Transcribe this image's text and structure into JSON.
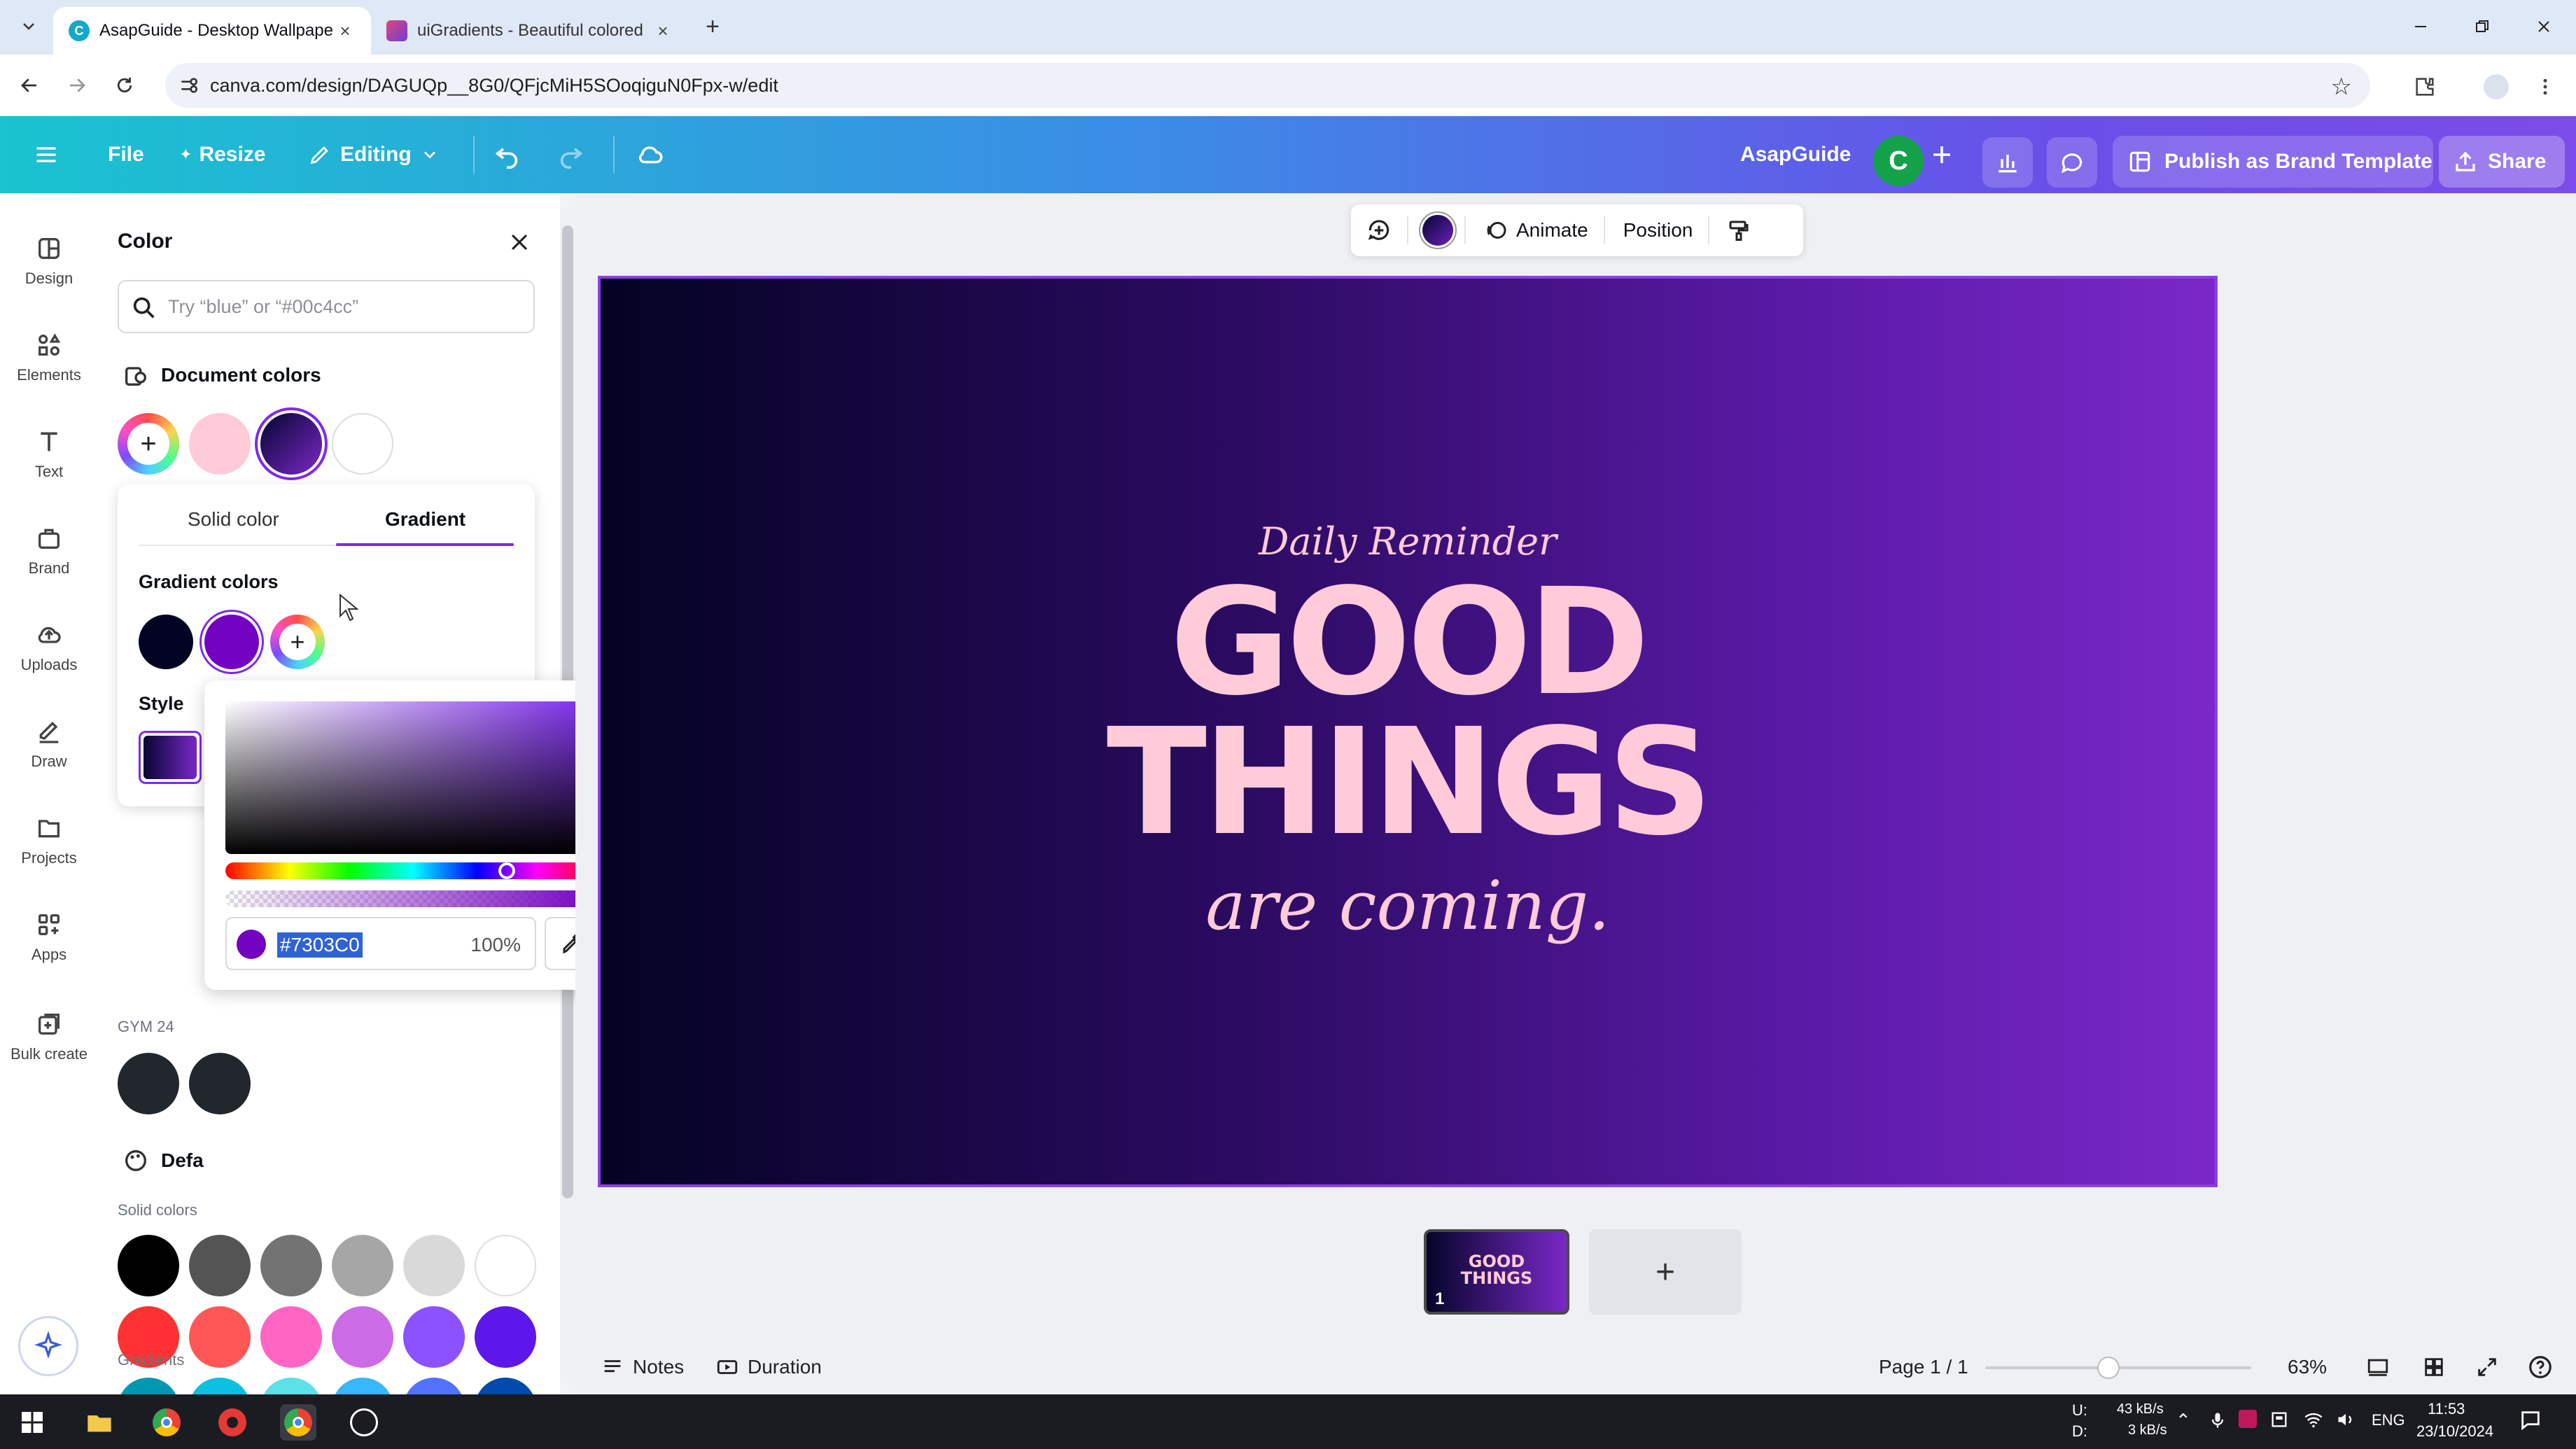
{
  "browser": {
    "tabs": [
      {
        "title": "AsapGuide - Desktop Wallpape",
        "active": true
      },
      {
        "title": "uiGradients - Beautiful colored",
        "active": false
      }
    ],
    "url": "canva.com/design/DAGUQp__8G0/QFjcMiH5SOoqiguN0Fpx-w/edit"
  },
  "header": {
    "file": "File",
    "resize": "Resize",
    "editing": "Editing",
    "brand_name": "AsapGuide",
    "avatar_initial": "C",
    "publish": "Publish as Brand Template",
    "share": "Share"
  },
  "rail": {
    "items": [
      {
        "label": "Design"
      },
      {
        "label": "Elements"
      },
      {
        "label": "Text"
      },
      {
        "label": "Brand"
      },
      {
        "label": "Uploads"
      },
      {
        "label": "Draw"
      },
      {
        "label": "Projects"
      },
      {
        "label": "Apps"
      },
      {
        "label": "Bulk create"
      }
    ]
  },
  "color_panel": {
    "title": "Color",
    "search_placeholder": "Try “blue” or “#00c4cc”",
    "document_colors_label": "Document colors",
    "document_colors": [
      "#ffcbd8",
      "#5b1aa7",
      "#ffffff"
    ],
    "tabs": {
      "solid": "Solid color",
      "gradient": "Gradient"
    },
    "gradient_colors_label": "Gradient colors",
    "gradient_colors": [
      "#030323",
      "#7303c0"
    ],
    "style_label": "Style",
    "brand_kit_label": "GYM 24",
    "default_label": "Defa",
    "solid_colors_label": "Solid colors",
    "solid_colors": [
      "#000000",
      "#545454",
      "#737373",
      "#a6a6a6",
      "#d9d9d9",
      "#ffffff",
      "#ff3131",
      "#ff5757",
      "#ff66c4",
      "#cb6ce6",
      "#8c52ff",
      "#5e17eb",
      "#0097b2",
      "#0cc0df",
      "#5ce1e6",
      "#38b6ff",
      "#5271ff",
      "#004aad",
      "#00bf63",
      "#7ed957",
      "#c1ff72",
      "#ffde59",
      "#ffbd59",
      "#ff914d"
    ],
    "gradients_label": "Gradients"
  },
  "picker": {
    "hex": "#7303C0",
    "opacity": "100%",
    "current_color": "#7303c0"
  },
  "context_toolbar": {
    "animate": "Animate",
    "position": "Position"
  },
  "canvas": {
    "line1": "Daily Reminder",
    "line2": "GOOD",
    "line3": "THINGS",
    "line4": "are coming."
  },
  "pages": {
    "thumb_line1": "GOOD",
    "thumb_line2": "THINGS",
    "thumb_number": "1",
    "add_symbol": "+"
  },
  "footer": {
    "notes": "Notes",
    "duration": "Duration",
    "page_indicator": "Page 1 / 1",
    "zoom": "63%"
  },
  "taskbar": {
    "net_up_label": "U:",
    "net_down_label": "D:",
    "net_up": "43 kB/s",
    "net_down": "3 kB/s",
    "lang": "ENG",
    "time": "11:53",
    "date": "23/10/2024"
  },
  "colors": {
    "accent": "#7d2ae8",
    "canvas_text": "#ffcbd8"
  }
}
